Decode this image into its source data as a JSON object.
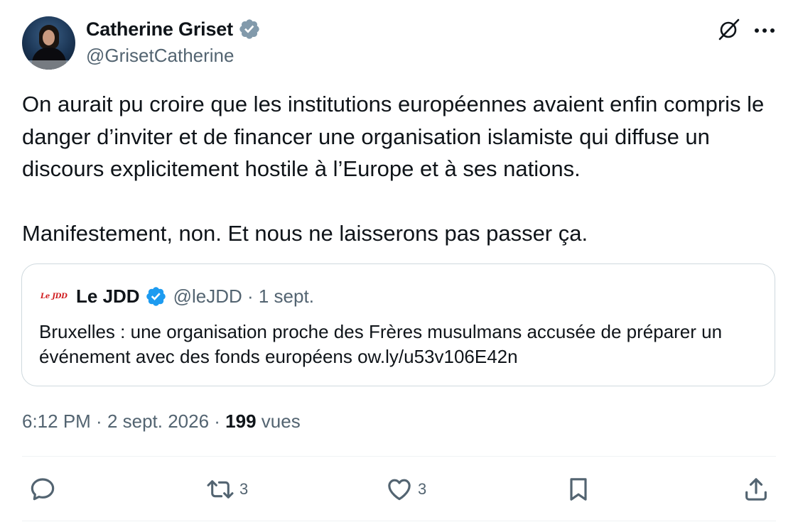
{
  "author": {
    "display_name": "Catherine Griset",
    "handle": "@GrisetCatherine",
    "verified": true
  },
  "tweet": {
    "paragraphs": [
      "On aurait pu croire que les institutions européennes avaient enfin compris le danger d’inviter et de financer une organisation islamiste qui diffuse un discours explicitement hostile à l’Europe et à ses nations.",
      "Manifestement, non. Et nous ne laisserons pas passer ça."
    ]
  },
  "quote": {
    "logo_text": "Le JDD",
    "display_name": "Le JDD",
    "handle": "@leJDD",
    "separator": " · ",
    "date": "1 sept.",
    "body": "Bruxelles : une organisation proche des Frères musulmans accusée de préparer un événement avec des fonds européens ow.ly/u53v106E42n"
  },
  "meta": {
    "time": "6:12 PM",
    "separator": " · ",
    "date": "2 sept. 2026",
    "separator2": " · ",
    "views_count": "199",
    "views_label": " vues"
  },
  "actions": {
    "reply_count": "",
    "retweet_count": "3",
    "like_count": "3"
  },
  "colors": {
    "text": "#0f1419",
    "muted": "#536471",
    "verified_blue": "#1d9bf0",
    "verified_gray": "#829aab",
    "border": "#cfd9de",
    "brand_red": "#d01c1f"
  },
  "icons": [
    "verified-gray-badge-icon",
    "grok-icon",
    "more-dots-icon",
    "verified-blue-badge-icon",
    "reply-icon",
    "retweet-icon",
    "like-icon",
    "bookmark-icon",
    "share-icon"
  ]
}
